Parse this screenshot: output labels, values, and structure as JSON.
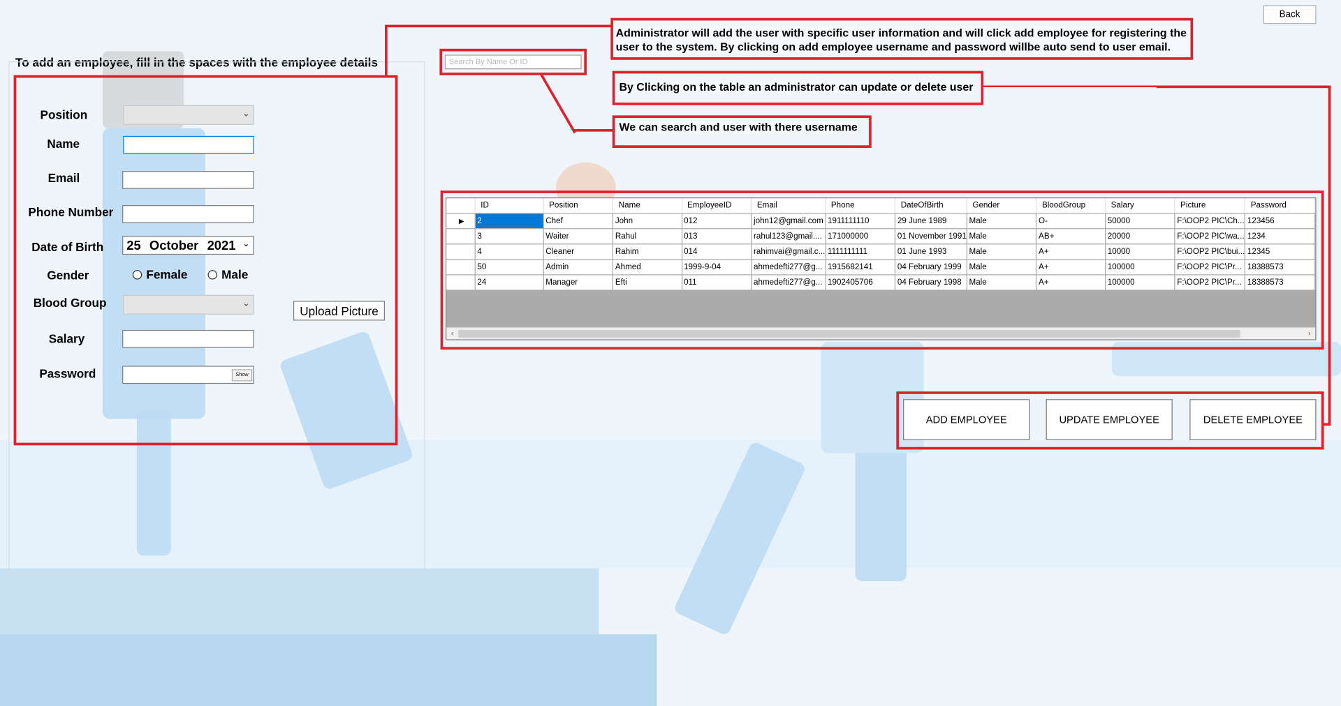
{
  "header": {
    "back_label": "Back"
  },
  "form": {
    "title": "To add an employee, fill in the spaces with the employee details",
    "position_label": "Position",
    "name_label": "Name",
    "name_value": "",
    "email_label": "Email",
    "email_value": "",
    "phone_label": "Phone Number",
    "phone_value": "",
    "dob_label": "Date of Birth",
    "dob_day": "25",
    "dob_month": "October",
    "dob_year": "2021",
    "gender_label": "Gender",
    "gender_female": "Female",
    "gender_male": "Male",
    "blood_group_label": "Blood Group",
    "upload_label": "Upload Picture",
    "salary_label": "Salary",
    "salary_value": "",
    "password_label": "Password",
    "password_value": "",
    "show_label": "Show"
  },
  "search": {
    "placeholder": "Search By Name Or ID"
  },
  "notes": {
    "add": "Administrator will add the user with specific user information and will click add employee for registering the user to the system. By clicking on add employee username and password willbe auto send to user email.",
    "table": "By Clicking on the table an administrator can update or delete user",
    "search": "We can search and user with there username"
  },
  "table": {
    "columns": [
      "ID",
      "Position",
      "Name",
      "EmployeeID",
      "Email",
      "Phone",
      "DateOfBirth",
      "Gender",
      "BloodGroup",
      "Salary",
      "Picture",
      "Password"
    ],
    "rows": [
      [
        "2",
        "Chef",
        "John",
        "012",
        "john12@gmail.com",
        "1911111110",
        "29 June 1989",
        "Male",
        "O-",
        "50000",
        "F:\\OOP2 PIC\\Ch...",
        "123456"
      ],
      [
        "3",
        "Waiter",
        "Rahul",
        "013",
        "rahul123@gmail....",
        "171000000",
        "01 November 1991",
        "Male",
        "AB+",
        "20000",
        "F:\\OOP2 PIC\\wa...",
        "1234"
      ],
      [
        "4",
        "Cleaner",
        "Rahim",
        "014",
        "rahimvai@gmail.c...",
        "1111111111",
        "01 June 1993",
        "Male",
        "A+",
        "10000",
        "F:\\OOP2 PIC\\bui...",
        "12345"
      ],
      [
        "50",
        "Admin",
        "Ahmed",
        "1999-9-04",
        "ahmedefti277@g...",
        "1915682141",
        "04 February 1999",
        "Male",
        "A+",
        "100000",
        "F:\\OOP2 PIC\\Pr...",
        "18388573"
      ],
      [
        "24",
        "Manager",
        "Efti",
        "011",
        "ahmedefti277@g...",
        "1902405706",
        "04 February 1998",
        "Male",
        "A+",
        "100000",
        "F:\\OOP2 PIC\\Pr...",
        "18388573"
      ]
    ]
  },
  "actions": {
    "add": "ADD EMPLOYEE",
    "update": "UPDATE EMPLOYEE",
    "delete": "DELETE EMPLOYEE"
  },
  "colors": {
    "annotation_red": "#e0202c",
    "selection_blue": "#0078d7"
  }
}
